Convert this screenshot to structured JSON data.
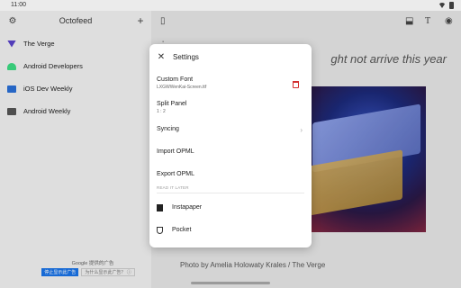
{
  "status": {
    "time": "11:00"
  },
  "sidebar": {
    "title": "Octofeed",
    "feeds": [
      {
        "label": "The Verge",
        "icon": "verge-icon",
        "color": "#5a43c9"
      },
      {
        "label": "Android Developers",
        "icon": "android-icon",
        "color": "#3ddc84"
      },
      {
        "label": "iOS Dev Weekly",
        "icon": "iosdev-icon",
        "color": "#2a6fd6"
      },
      {
        "label": "Android Weekly",
        "icon": "androidweekly-icon",
        "color": "#555555"
      }
    ],
    "ad": {
      "title": "Google 提供的广告",
      "stop_label": "停止显示此广告",
      "why_label": "为什么显示此广告？ ⓘ"
    }
  },
  "article": {
    "title_fragment": "ght not arrive this year",
    "caption": "Photo by Amelia Holowaty Krales / The Verge"
  },
  "settings": {
    "title": "Settings",
    "custom_font_label": "Custom Font",
    "custom_font_value": "LXGWWenKai-Screen.ttf",
    "split_panel_label": "Split Panel",
    "split_panel_value": "1 : 2",
    "syncing_label": "Syncing",
    "import_label": "Import OPML",
    "export_label": "Export OPML",
    "read_later_label": "READ IT LATER",
    "instapaper_label": "Instapaper",
    "pocket_label": "Pocket"
  },
  "colors": {
    "accent_red": "#d32f2f",
    "ad_button": "#1a73e8"
  }
}
